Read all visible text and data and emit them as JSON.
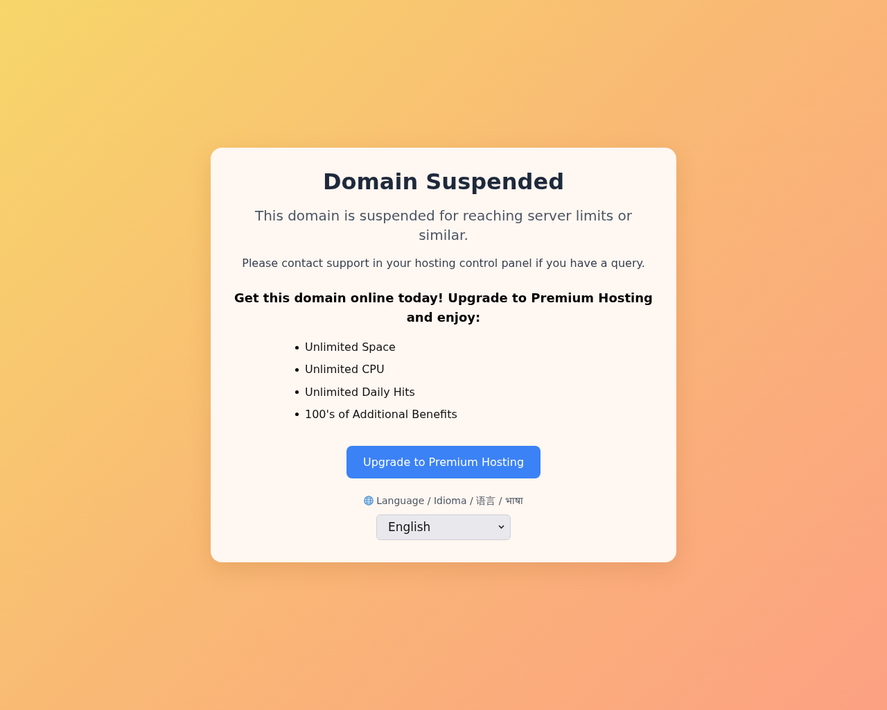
{
  "card": {
    "title": "Domain Suspended",
    "subtitle": "This domain is suspended for reaching server limits or similar.",
    "note": "Please contact support in your hosting control panel if you have a query.",
    "offer_heading": "Get this domain online today! Upgrade to Premium Hosting and enjoy:",
    "benefits": [
      "Unlimited Space",
      "Unlimited CPU",
      "Unlimited Daily Hits",
      "100's of Additional Benefits"
    ],
    "upgrade_button": "Upgrade to Premium Hosting",
    "language_label": "Language / Idioma / 语言 / भाषा",
    "language_select": {
      "value": "English"
    }
  }
}
